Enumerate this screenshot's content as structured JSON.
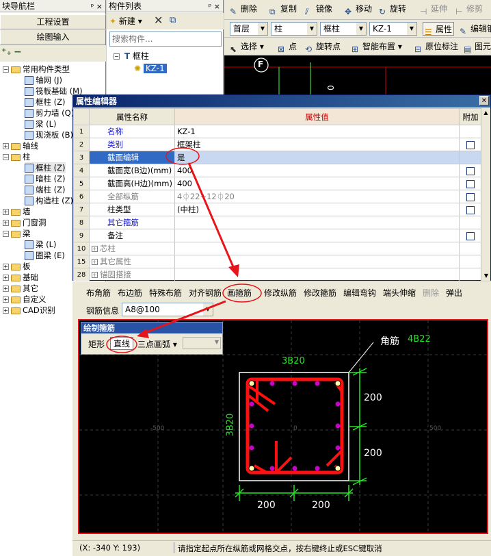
{
  "nav": {
    "title": "块导航栏",
    "pin": "ᵖ ×",
    "btn_project": "工程设置",
    "btn_draw": "绘图输入",
    "tree": [
      {
        "label": "常用构件类型",
        "type": "folder",
        "exp": "−"
      },
      {
        "label": "轴网 (J)",
        "type": "item"
      },
      {
        "label": "筏板基础 (M)",
        "type": "item"
      },
      {
        "label": "框柱 (Z)",
        "type": "item"
      },
      {
        "label": "剪力墙 (Q)",
        "type": "item"
      },
      {
        "label": "梁 (L)",
        "type": "item"
      },
      {
        "label": "现浇板 (B)",
        "type": "item"
      },
      {
        "label": "轴线",
        "type": "folder",
        "exp": "+"
      },
      {
        "label": "柱",
        "type": "folder",
        "exp": "−"
      },
      {
        "label": "框柱 (Z)",
        "type": "item"
      },
      {
        "label": "暗柱 (Z)",
        "type": "item"
      },
      {
        "label": "端柱 (Z)",
        "type": "item"
      },
      {
        "label": "构造柱 (Z)",
        "type": "item"
      },
      {
        "label": "墙",
        "type": "folder",
        "exp": "+"
      },
      {
        "label": "门窗洞",
        "type": "folder",
        "exp": "+"
      },
      {
        "label": "梁",
        "type": "folder",
        "exp": "−"
      },
      {
        "label": "梁 (L)",
        "type": "item"
      },
      {
        "label": "圈梁 (E)",
        "type": "item"
      },
      {
        "label": "板",
        "type": "folder",
        "exp": "+"
      },
      {
        "label": "基础",
        "type": "folder",
        "exp": "+"
      },
      {
        "label": "其它",
        "type": "folder",
        "exp": "+"
      },
      {
        "label": "自定义",
        "type": "folder",
        "exp": "+"
      },
      {
        "label": "CAD识别",
        "type": "folder",
        "exp": "+"
      }
    ]
  },
  "components": {
    "title": "构件列表",
    "new_label": "新建",
    "search_placeholder": "搜索构件...",
    "group": "框柱",
    "item": "KZ-1"
  },
  "toolbar": {
    "delete": "删除",
    "copy": "复制",
    "mirror": "镜像",
    "move": "移动",
    "rotate": "旋转",
    "extend": "延伸",
    "modify": "修剪",
    "floor": "首层",
    "category": "柱",
    "type": "框柱",
    "member": "KZ-1",
    "property": "属性",
    "edit_rebar": "编辑钢",
    "select": "选择",
    "point": "点",
    "rotate_point": "旋转点",
    "smart_place": "智能布置",
    "mark": "原位标注",
    "element": "图元"
  },
  "canvas_top": {
    "axis_label": "F",
    "dim_text": "0"
  },
  "prop_editor": {
    "title": "属性编辑器",
    "header_name": "属性名称",
    "header_value": "属性值",
    "header_add": "附加",
    "rows": [
      {
        "num": "1",
        "name": "名称",
        "value": "KZ-1",
        "check": false,
        "name_color": "#1a1ad0"
      },
      {
        "num": "2",
        "name": "类别",
        "value": "框架柱",
        "check": true,
        "name_color": "#1a1ad0"
      },
      {
        "num": "3",
        "name": "截面编辑",
        "value": "是",
        "check": false,
        "name_color": "#1a1ad0"
      },
      {
        "num": "4",
        "name": "截面宽(B边)(mm)",
        "value": "400",
        "check": true,
        "name_color": "#000"
      },
      {
        "num": "5",
        "name": "截面高(H边)(mm)",
        "value": "400",
        "check": true,
        "name_color": "#000"
      },
      {
        "num": "6",
        "name": "全部纵筋",
        "value": "4⏀22+12⏀20",
        "check": true,
        "name_color": "#808080"
      },
      {
        "num": "7",
        "name": "柱类型",
        "value": "(中柱)",
        "check": true,
        "name_color": "#000"
      },
      {
        "num": "8",
        "name": "其它箍筋",
        "value": "",
        "check": false,
        "name_color": "#1a1ad0"
      },
      {
        "num": "9",
        "name": "备注",
        "value": "",
        "check": true,
        "name_color": "#000"
      },
      {
        "num": "10",
        "name": "芯柱",
        "value": "",
        "check": false,
        "name_color": "#808080",
        "exp": "+"
      },
      {
        "num": "15",
        "name": "其它属性",
        "value": "",
        "check": false,
        "name_color": "#808080",
        "exp": "+"
      },
      {
        "num": "28",
        "name": "锚固搭接",
        "value": "",
        "check": false,
        "name_color": "#808080",
        "exp": "+"
      }
    ]
  },
  "section_tools": {
    "buttons": [
      "布角筋",
      "布边筋",
      "特殊布筋",
      "对齐钢筋",
      "画箍筋",
      "修改纵筋",
      "修改箍筋",
      "编辑弯钩",
      "端头伸缩",
      "删除",
      "弹出"
    ],
    "rebar_info_label": "钢筋信息",
    "rebar_info_value": "A8@100"
  },
  "draw_stirrup": {
    "title": "绘制箍筋",
    "rect": "矩形",
    "line": "直线",
    "arc": "三点画弧"
  },
  "section": {
    "corner_label": "角筋",
    "corner_value": "4B22",
    "top_label": "3B20",
    "left_label": "3B20",
    "dim_right_1": "200",
    "dim_right_2": "200",
    "dim_bottom_1": "200",
    "dim_bottom_2": "200",
    "grid_left": "-500",
    "grid_right": "500",
    "grid_center": "0"
  },
  "status": {
    "coords": "(X: -340 Y: 193)",
    "hint": "请指定起点所在纵筋或网格交点，按右键终止或ESC键取消"
  },
  "colors": {
    "accent_red": "#e8141b",
    "title_blue": "#0a246a",
    "dim_green": "#22e622"
  }
}
